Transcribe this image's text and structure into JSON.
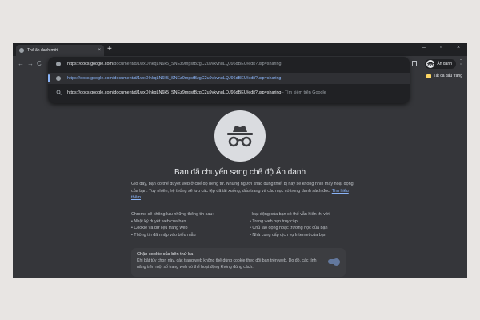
{
  "tab": {
    "title": "Thẻ ẩn danh mới",
    "close": "×",
    "new_tab": "+"
  },
  "window_controls": {
    "minimize": "–",
    "maximize": "▫",
    "close": "×"
  },
  "toolbar": {
    "profile_label": "Ẩn danh",
    "menu": "⋮"
  },
  "bookmarks": {
    "folder_label": "Tất cả dấu trang"
  },
  "omnibox": {
    "input_host": "https://docs.google.com",
    "input_rest": "/document/d/1wxDlnkqLN6k5_SNEz9mpstBzgC2u9vkvnuLQJ96dBEU/edit?usp=sharing",
    "suggestion_url": "https://docs.google.com/document/d/1wxDlnkqLN6k5_SNEz9mpstBzgC2u9vkvnuLQJ96dBEU/edit?usp=sharing",
    "search_query": "https://docs.google.com/document/d/1wxDlnkqLN6k5_SNEz9mpstBzgC2u9vkvnuLQJ96dBEU/edit?usp=sharing",
    "search_hint": " – Tìm kiếm trên Google"
  },
  "page": {
    "heading": "Bạn đã chuyển sang chế độ Ẩn danh",
    "intro": "Giờ đây, bạn có thể duyệt web ở chế độ riêng tư. Những người khác dùng thiết bị này sẽ không nhìn thấy hoạt động của bạn. Tuy nhiên, hệ thống sẽ lưu các tệp đã tải xuống, dấu trang và các mục có trong danh sách đọc.",
    "learn_more": "Tìm hiểu thêm",
    "left_col": {
      "title": "Chrome sẽ không lưu những thông tin sau:",
      "items": [
        "Nhật ký duyệt web của bạn",
        "Cookie và dữ liệu trang web",
        "Thông tin đã nhập vào biểu mẫu"
      ]
    },
    "right_col": {
      "title": "Hoạt động của bạn có thể vẫn hiển thị với:",
      "items": [
        "Trang web bạn truy cập",
        "Chủ lao động hoặc trường học của bạn",
        "Nhà cung cấp dịch vụ Internet của bạn"
      ]
    },
    "cookie_card": {
      "title": "Chặn cookie của bên thứ ba",
      "desc": "Khi bật tùy chọn này, các trang web không thể dùng cookie theo dõi bạn trên web. Do đó, các tính năng trên một số trang web có thể hoạt động không đúng cách."
    }
  }
}
